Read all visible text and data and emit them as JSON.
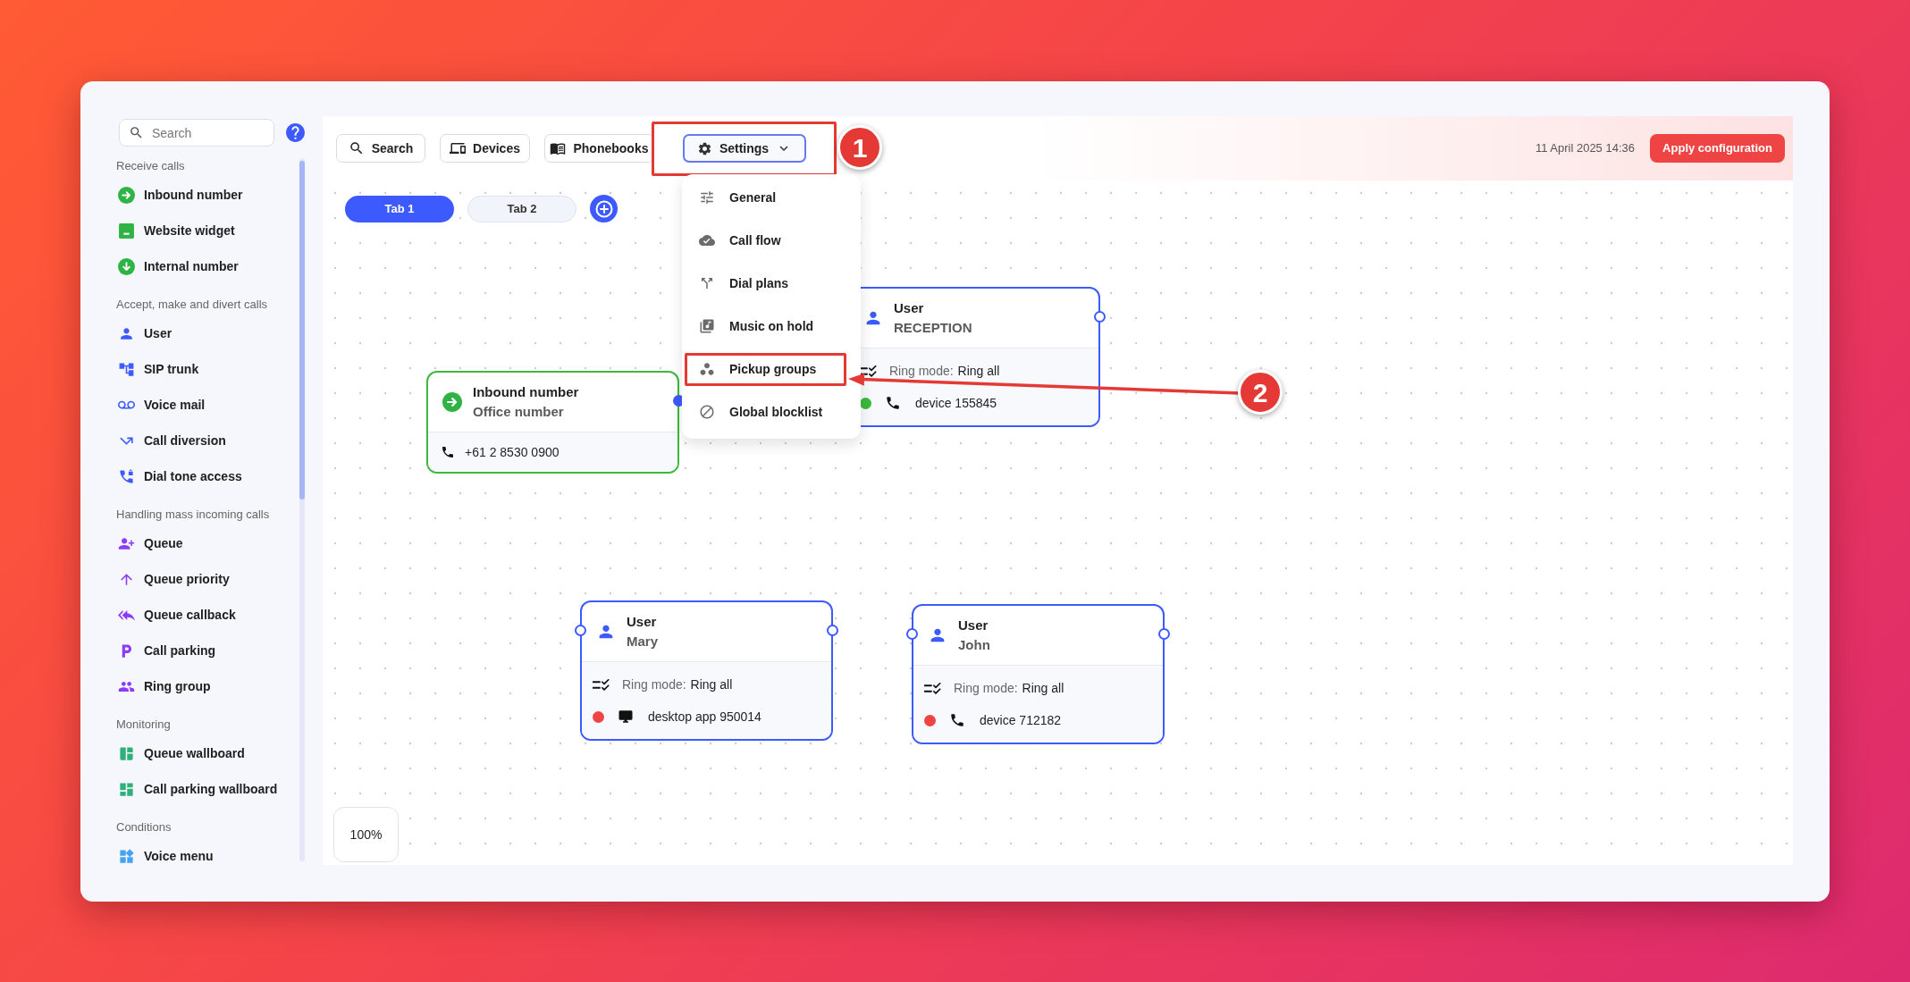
{
  "sidebar": {
    "search": {
      "placeholder": "Search"
    },
    "sections": [
      {
        "title": "Receive calls",
        "items": [
          "Inbound number",
          "Website widget",
          "Internal number"
        ]
      },
      {
        "title": "Accept, make and divert calls",
        "items": [
          "User",
          "SIP trunk",
          "Voice mail",
          "Call diversion",
          "Dial tone access"
        ]
      },
      {
        "title": "Handling mass incoming calls",
        "items": [
          "Queue",
          "Queue priority",
          "Queue callback",
          "Call parking",
          "Ring group"
        ]
      },
      {
        "title": "Monitoring",
        "items": [
          "Queue wallboard",
          "Call parking wallboard"
        ]
      },
      {
        "title": "Conditions",
        "items": [
          "Voice menu"
        ]
      }
    ]
  },
  "toolbar": {
    "buttons": [
      "Search",
      "Devices",
      "Phonebooks"
    ],
    "settings": {
      "label": "Settings",
      "expanded": true,
      "callout": "1",
      "items": [
        {
          "label": "General"
        },
        {
          "label": "Call flow"
        },
        {
          "label": "Dial plans"
        },
        {
          "label": "Music on hold"
        },
        {
          "label": "Pickup groups",
          "callout": "2"
        },
        {
          "label": "Global blocklist"
        }
      ]
    },
    "datetime": "11 April 2025 14:36",
    "apply_button": "Apply configuration"
  },
  "tabs": [
    {
      "label": "Tab 1",
      "selected": true
    },
    {
      "label": "Tab 2",
      "selected": false
    }
  ],
  "canvas": {
    "nodes": [
      {
        "kind": "inbound",
        "title": "Inbound number",
        "subtitle": "Office number",
        "number": "+61 2 8530 0900"
      },
      {
        "kind": "user",
        "title": "User",
        "subtitle": "RECEPTION",
        "ring_mode_label": "Ring mode:",
        "ring_mode": "Ring all",
        "device": {
          "kind": "phone",
          "label": "device 155845",
          "color": "#3cb83c"
        }
      },
      {
        "kind": "user",
        "title": "User",
        "subtitle": "Mary",
        "ring_mode_label": "Ring mode:",
        "ring_mode": "Ring all",
        "device": {
          "kind": "desktop",
          "label": "desktop app 950014",
          "color": "#ef4444"
        }
      },
      {
        "kind": "user",
        "title": "User",
        "subtitle": "John",
        "ring_mode_label": "Ring mode:",
        "ring_mode": "Ring all",
        "device": {
          "kind": "phone",
          "label": "device 712182",
          "color": "#ef4444"
        }
      }
    ],
    "zoom": "100%"
  }
}
